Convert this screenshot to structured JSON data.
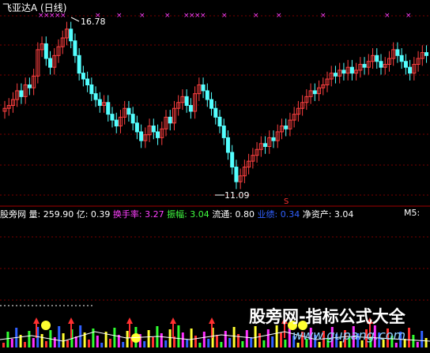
{
  "header": {
    "title": "飞亚达A (日线)"
  },
  "price_labels": {
    "high": "16.78",
    "low": "11.09"
  },
  "signal_mark": "S",
  "info_bar": {
    "items": [
      {
        "label": "股旁网",
        "value": "",
        "color": "#ffffff"
      },
      {
        "label": "量:",
        "value": "259.90",
        "color": "#ffffff"
      },
      {
        "label": "亿:",
        "value": "0.39",
        "color": "#ffffff"
      },
      {
        "label": "换手率:",
        "value": "3.27",
        "color": "#ff40ff"
      },
      {
        "label": "振幅:",
        "value": "3.04",
        "color": "#40ff40"
      },
      {
        "label": "流通:",
        "value": "0.80",
        "color": "#ffffff"
      },
      {
        "label": "业绩:",
        "value": "0.34",
        "color": "#3060ff"
      },
      {
        "label": "净资产:",
        "value": "3.04",
        "color": "#ffffff"
      }
    ],
    "m5": "M5:"
  },
  "watermark": {
    "cn": "股旁网-指标公式大全",
    "url": "www.gupang.com"
  },
  "colors": {
    "up": "#ff4040",
    "down": "#54ffff",
    "grid": "#7a0000",
    "marker": "#ff40ff"
  },
  "chart_data": {
    "type": "candlestick",
    "high_point": 16.78,
    "low_point": 11.09,
    "closes": [
      13.8,
      13.9,
      14.1,
      14.4,
      14.2,
      14.6,
      14.5,
      14.9,
      15.8,
      16.0,
      15.5,
      15.2,
      15.6,
      15.9,
      16.2,
      16.5,
      16.1,
      15.6,
      15.0,
      14.8,
      14.6,
      14.3,
      14.1,
      13.9,
      14.0,
      13.6,
      13.4,
      13.2,
      13.5,
      13.8,
      13.6,
      13.3,
      13.0,
      12.7,
      12.9,
      13.2,
      13.0,
      12.8,
      13.1,
      13.5,
      13.3,
      13.8,
      14.0,
      14.2,
      13.9,
      13.7,
      14.3,
      14.6,
      14.4,
      14.1,
      13.8,
      13.5,
      13.2,
      12.8,
      12.3,
      11.8,
      11.3,
      11.5,
      11.8,
      12.0,
      12.2,
      12.4,
      12.6,
      12.5,
      12.8,
      12.7,
      13.0,
      13.2,
      13.1,
      13.4,
      13.6,
      13.8,
      14.0,
      14.2,
      14.4,
      14.3,
      14.5,
      14.6,
      14.8,
      15.0,
      14.9,
      15.1,
      15.0,
      15.2,
      15.0,
      15.1,
      15.3,
      15.2,
      15.4,
      15.6,
      15.4,
      15.2,
      15.3,
      15.5,
      15.8,
      15.6,
      15.4,
      15.2,
      15.0,
      15.3,
      15.5,
      15.7,
      15.6
    ],
    "volume_axis_level": 0
  }
}
